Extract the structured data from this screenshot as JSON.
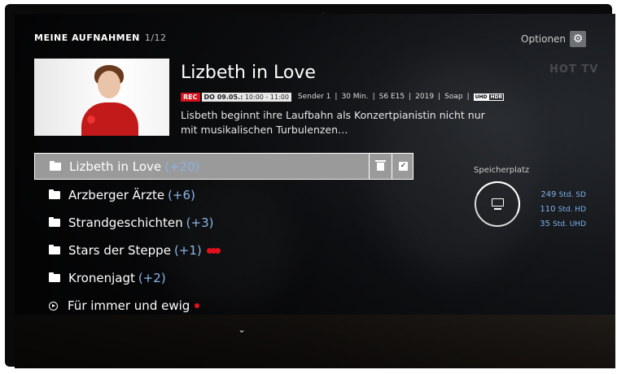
{
  "header": {
    "title": "MEINE AUFNAHMEN",
    "count": "1/12"
  },
  "options_label": "Optionen",
  "channel_logo": "HOT TV",
  "detail": {
    "title": "Lizbeth in Love",
    "rec_badge": "REC",
    "date": "DO 09.05.:",
    "time": " 10:00 - 11:00",
    "channel": "Sender 1",
    "duration": "30 Min.",
    "episode": "S6 E15",
    "year": "2019",
    "genre": "Soap",
    "uhd": "UHD",
    "hdr": "HDR",
    "description": "Lisbeth beginnt ihre Laufbahn als Konzertpianistin nicht nur mit musikalischen Turbulenzen…"
  },
  "list": [
    {
      "label": "Lizbeth in Love",
      "count": "(+20)",
      "type": "folder",
      "selected": true
    },
    {
      "label": "Arzberger Ärzte",
      "count": "(+6)",
      "type": "folder"
    },
    {
      "label": "Strandgeschichten",
      "count": "(+3)",
      "type": "folder"
    },
    {
      "label": "Stars der Steppe",
      "count": "(+1)",
      "type": "folder",
      "recording_multi": true
    },
    {
      "label": "Kronenjagt",
      "count": "(+2)",
      "type": "folder"
    },
    {
      "label": "Für immer und ewig",
      "count": "",
      "type": "play",
      "recording": true
    }
  ],
  "storage": {
    "label": "Speicherplatz",
    "sd": {
      "value": "249",
      "unit": "Std. SD"
    },
    "hd": {
      "value": "110",
      "unit": "Std. HD"
    },
    "uhd": {
      "value": "35",
      "unit": "Std. UHD"
    }
  },
  "colors": {
    "accent": "#8ab4e6",
    "rec": "#d4111d",
    "selected_bg": "#9a9a9a"
  },
  "icons": {
    "options": "gear-icon",
    "delete": "trash-icon",
    "select": "checkbox-icon",
    "more": "chevron-down-icon",
    "storage": "monitor-icon"
  }
}
